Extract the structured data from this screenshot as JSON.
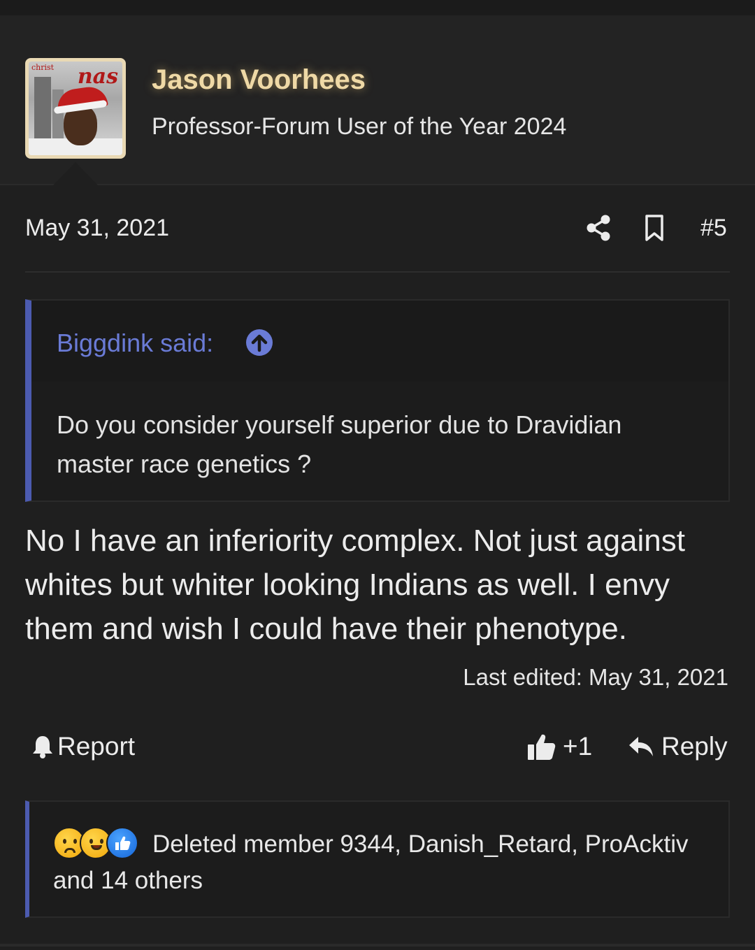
{
  "author": {
    "name": "Jason Voorhees",
    "title": "Professor-Forum User of the Year 2024",
    "avatar_text": "nas",
    "avatar_small_text": "christ"
  },
  "post": {
    "date": "May 31, 2021",
    "number": "#5",
    "quote": {
      "author": "Biggdink said:",
      "text": "Do you consider yourself superior due to Dravidian master race genetics ?"
    },
    "message": "No I have an inferiority complex. Not just against whites but whiter looking Indians as well. I envy them and wish I could have their phenotype.",
    "last_edited": "Last edited: May 31, 2021"
  },
  "actions": {
    "report": "Report",
    "like": "+1",
    "reply": "Reply"
  },
  "reactions": {
    "icons": [
      "sad-emoji",
      "laugh-cry-emoji",
      "thumbs-up-emoji"
    ],
    "text": "Deleted member 9344, Danish_Retard, ProAcktiv and 14 others"
  },
  "colors": {
    "background": "#1f1f1f",
    "header_bg": "#232323",
    "username": "#efd9a6",
    "quote_accent": "#4c5bb0",
    "quote_author": "#6a7bd6"
  }
}
